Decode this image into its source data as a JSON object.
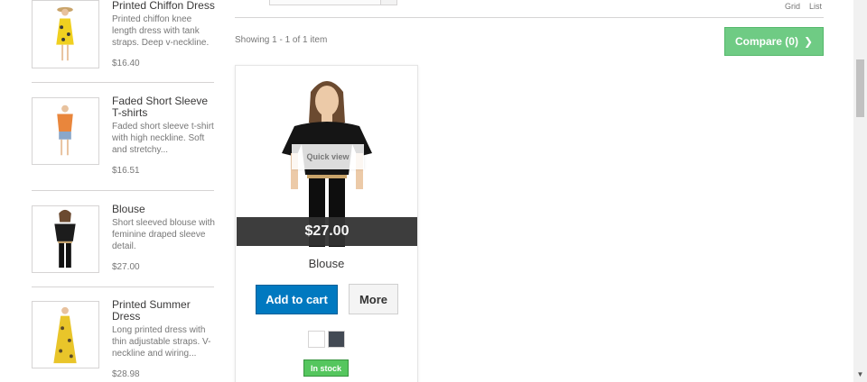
{
  "sidebar": {
    "items": [
      {
        "name": "Printed Chiffon Dress",
        "desc": "Printed chiffon knee length dress with tank straps. Deep v-neckline.",
        "price": "$16.40"
      },
      {
        "name": "Faded Short Sleeve T-shirts",
        "desc": "Faded short sleeve t-shirt with high neckline. Soft and stretchy...",
        "price": "$16.51"
      },
      {
        "name": "Blouse",
        "desc": "Short sleeved blouse with feminine draped sleeve detail.",
        "price": "$27.00"
      },
      {
        "name": "Printed Summer Dress",
        "desc": "Long printed dress with thin adjustable straps. V-neckline and wiring...",
        "price": "$28.98"
      }
    ]
  },
  "toolbar": {
    "view_grid": "Grid",
    "view_list": "List",
    "showing": "Showing 1 - 1 of 1 item",
    "compare_label": "Compare (0)"
  },
  "product": {
    "quick_view": "Quick view",
    "price": "$27.00",
    "name": "Blouse",
    "add_to_cart": "Add to cart",
    "more": "More",
    "availability": "In stock",
    "swatches": [
      "#ffffff",
      "#434a54"
    ]
  },
  "colors": {
    "accent_blue": "#0079c0",
    "compare_green": "#6fcb84",
    "stock_green": "#55c65e"
  }
}
